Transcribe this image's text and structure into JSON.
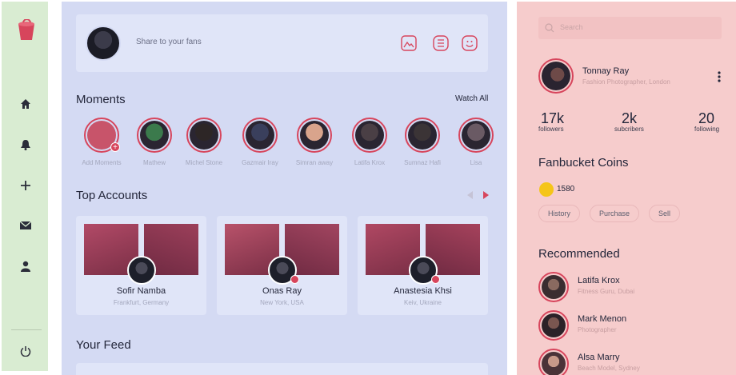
{
  "composer": {
    "placeholder": "Share to your fans",
    "icons": [
      "image-icon",
      "list-icon",
      "emoji-icon"
    ]
  },
  "moments": {
    "title": "Moments",
    "watch_all": "Watch All",
    "items": [
      {
        "name": "Add Moments",
        "color": "#c8546a"
      },
      {
        "name": "Mathew",
        "color": "#3b7a4c"
      },
      {
        "name": "Michel Stone",
        "color": "#2d2626"
      },
      {
        "name": "Gazmair Iray",
        "color": "#3a3f5c"
      },
      {
        "name": "Simran away",
        "color": "#d9a48c"
      },
      {
        "name": "Latifa Krox",
        "color": "#4a3f45"
      },
      {
        "name": "Sumnaz Hafi",
        "color": "#3b3436"
      },
      {
        "name": "Lisa",
        "color": "#6a5a64"
      }
    ]
  },
  "top_accounts": {
    "title": "Top Accounts",
    "items": [
      {
        "name": "Sofir Namba",
        "location": "Frankfurt, Germany"
      },
      {
        "name": "Onas Ray",
        "location": "New York, USA"
      },
      {
        "name": "Anastesia Khsi",
        "location": "Keiv, Ukraine"
      }
    ]
  },
  "feed": {
    "title": "Your Feed"
  },
  "right": {
    "search_placeholder": "Search",
    "profile": {
      "name": "Tonnay Ray",
      "role": "Fashion Photographer, London"
    },
    "stats": [
      {
        "value": "17k",
        "label": "followers"
      },
      {
        "value": "2k",
        "label": "subcribers"
      },
      {
        "value": "20",
        "label": "following"
      }
    ],
    "coins": {
      "title": "Fanbucket Coins",
      "amount": "1580",
      "actions": [
        "History",
        "Purchase",
        "Sell"
      ]
    },
    "recommended": {
      "title": "Recommended",
      "items": [
        {
          "name": "Latifa Krox",
          "desc": "Fitness Guru, Dubai"
        },
        {
          "name": "Mark Menon",
          "desc": "Photographer"
        },
        {
          "name": "Alsa Marry",
          "desc": "Beach Model, Sydney"
        }
      ]
    }
  },
  "colors": {
    "accent": "#d7455c",
    "rail_bg": "#d9ecd2",
    "main_bg": "#d4daf3",
    "right_bg": "#f6cccc",
    "coin": "#f5c518"
  }
}
